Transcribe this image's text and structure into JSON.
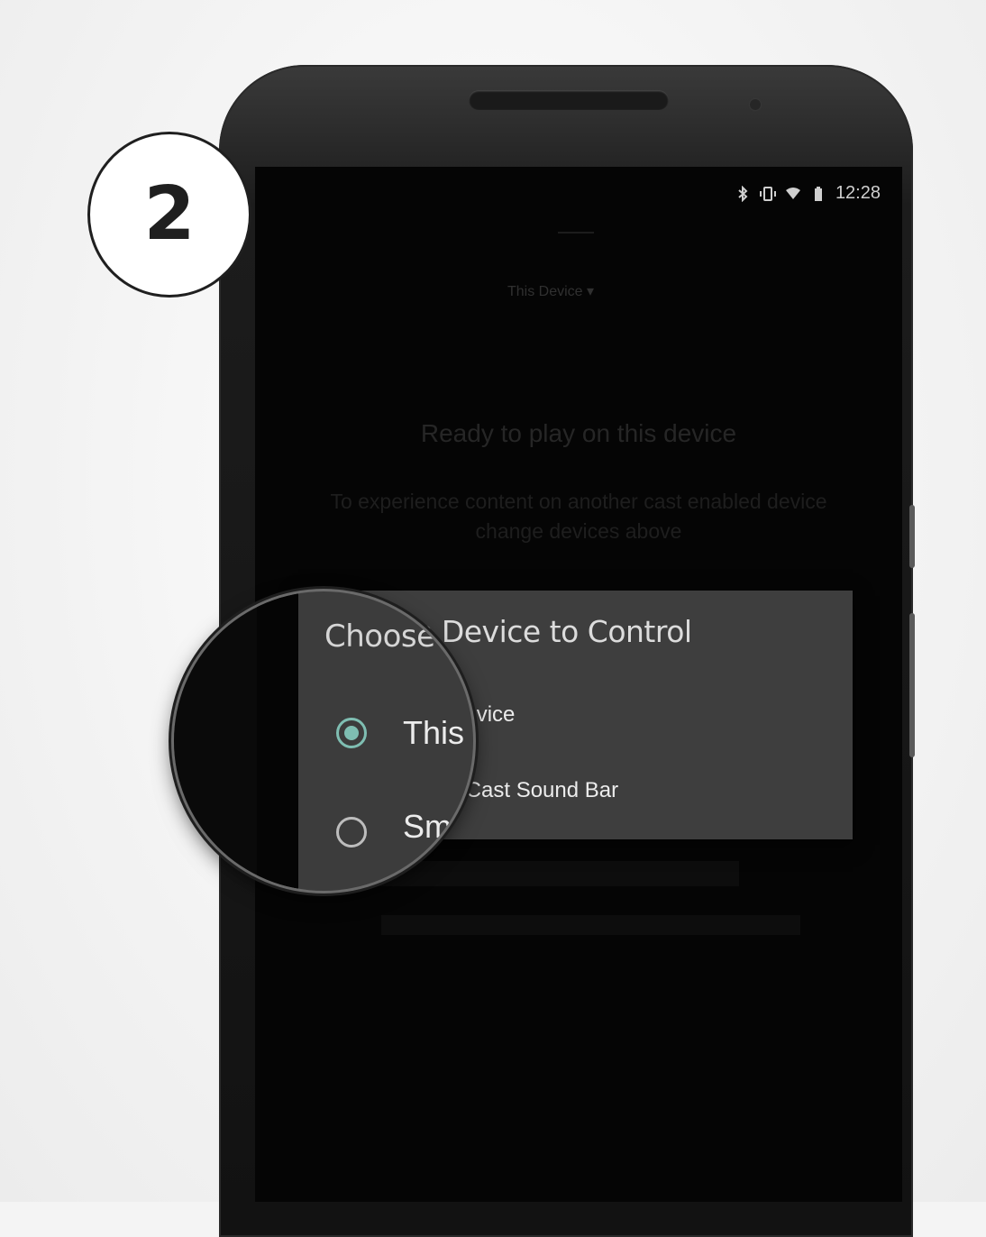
{
  "step": {
    "number": "2"
  },
  "status_bar": {
    "time": "12:28",
    "icons": [
      "bluetooth-icon",
      "vibrate-icon",
      "wifi-icon",
      "battery-icon"
    ]
  },
  "screen": {
    "device_selector": "This Device",
    "ready_title": "Ready to play on this device",
    "ready_subtitle": "To experience content on another cast enabled device change devices above"
  },
  "dialog": {
    "title": "Choose Device to Control",
    "options": [
      {
        "label": "This Device",
        "selected": true
      },
      {
        "label": "Smart Cast Sound Bar",
        "selected": false
      }
    ]
  },
  "magnifier": {
    "title": "Choose",
    "option1": "This",
    "option2": "Sm"
  },
  "colors": {
    "accent_radio": "#7fbeb2",
    "dialog_bg": "#3e3e3e",
    "screen_bg": "#050505"
  }
}
